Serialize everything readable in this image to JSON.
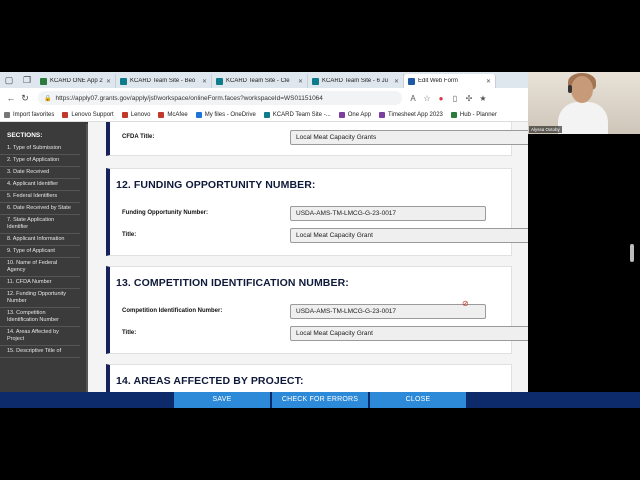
{
  "browser": {
    "tabs": [
      {
        "label": "KCARD ONE App 2023",
        "color": "#2b7a3e"
      },
      {
        "label": "KCARD Team Site - Beo",
        "color": "#0f7c8c"
      },
      {
        "label": "KCARD Team Site - Cle",
        "color": "#0f7c8c"
      },
      {
        "label": "KCARD Team Site - 6 Ju",
        "color": "#0f7c8c"
      },
      {
        "label": "Edit Web Form",
        "color": "#1c5aa6"
      }
    ],
    "url": "https://apply07.grants.gov/apply/jsf/workspace/onlineForm.faces?workspaceId=WS01151064",
    "bookmarks": [
      {
        "label": "Import favorites",
        "color": "#777777"
      },
      {
        "label": "Lenovo Support",
        "color": "#c0392b"
      },
      {
        "label": "Lenovo",
        "color": "#c0392b"
      },
      {
        "label": "McAfee",
        "color": "#c0392b"
      },
      {
        "label": "My files - OneDrive",
        "color": "#1e73d8"
      },
      {
        "label": "KCARD Team Site -...",
        "color": "#0f7c8c"
      },
      {
        "label": "One App",
        "color": "#7b3fa0"
      },
      {
        "label": "Timesheet App 2023",
        "color": "#7b3fa0"
      },
      {
        "label": "Hub - Planner",
        "color": "#2b7a3e"
      }
    ]
  },
  "sidebar": {
    "title": "SECTIONS:",
    "items": [
      "1. Type of Submission",
      "2. Type of Application",
      "3. Date Received",
      "4. Applicant Identifier",
      "5. Federal Identifiers",
      "6. Date Received by State",
      "7. State Application Identifier",
      "8. Applicant Information",
      "9. Type of Applicant",
      "10. Name of Federal Agency",
      "11. CFDA Number",
      "12. Funding Opportunity Number",
      "13. Competition Identification Number",
      "14. Areas Affected by Project",
      "15. Descriptive Title of"
    ]
  },
  "form": {
    "cfda_title_label": "CFDA Title:",
    "cfda_title_value": "Local Meat Capacity Grants",
    "sec12": {
      "title": "12. FUNDING OPPORTUNITY NUMBER:",
      "number_label": "Funding Opportunity Number:",
      "number_value": "USDA-AMS-TM-LMCG-G-23-0017",
      "title_label": "Title:",
      "title_value": "Local Meat Capacity Grant"
    },
    "sec13": {
      "title": "13. COMPETITION IDENTIFICATION NUMBER:",
      "number_label": "Competition Identification Number:",
      "number_value": "USDA-AMS-TM-LMCG-G-23-0017",
      "title_label": "Title:",
      "title_value": "Local Meat Capacity Grant"
    },
    "sec14": {
      "title": "14. AREAS AFFECTED BY PROJECT:"
    }
  },
  "actions": {
    "save": "SAVE",
    "check": "CHECK FOR ERRORS",
    "close": "CLOSE"
  },
  "webcam": {
    "name": "Alyssa Oxtoby"
  }
}
